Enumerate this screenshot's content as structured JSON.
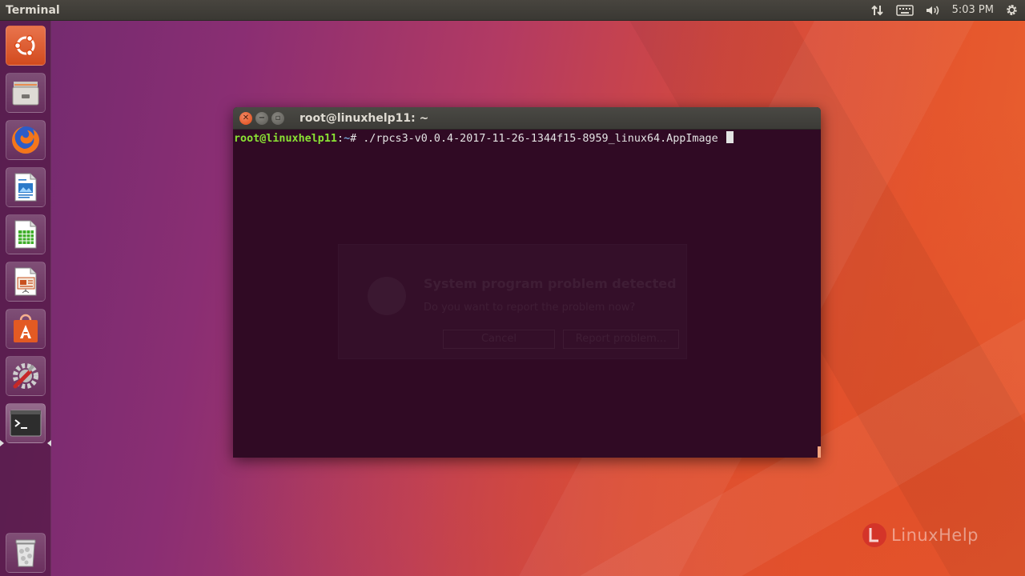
{
  "top_panel": {
    "app_title": "Terminal",
    "clock": "5:03 PM",
    "indicators": [
      "network-icon",
      "keyboard-icon",
      "volume-icon",
      "settings-gear-icon"
    ]
  },
  "launcher": {
    "items": [
      {
        "name": "ubuntu-dash",
        "icon": "ubuntu-logo-icon"
      },
      {
        "name": "files",
        "icon": "file-cabinet-icon"
      },
      {
        "name": "firefox",
        "icon": "firefox-icon"
      },
      {
        "name": "libreoffice-writer",
        "icon": "writer-document-icon"
      },
      {
        "name": "libreoffice-calc",
        "icon": "calc-spreadsheet-icon"
      },
      {
        "name": "libreoffice-impress",
        "icon": "impress-presentation-icon"
      },
      {
        "name": "ubuntu-software",
        "icon": "software-bag-icon"
      },
      {
        "name": "system-settings",
        "icon": "settings-tools-icon"
      },
      {
        "name": "terminal",
        "icon": "terminal-icon",
        "active": true
      },
      {
        "name": "trash",
        "icon": "trash-icon"
      }
    ]
  },
  "terminal": {
    "title": "root@linuxhelp11: ~",
    "prompt_user": "root@linuxhelp11",
    "prompt_path": "~",
    "prompt_symbol": "# ",
    "command": "./rpcs3-v0.0.4-2017-11-26-1344f15-8959_linux64.AppImage "
  },
  "background_dialog": {
    "title": "System program problem detected",
    "message": "Do you want to report the problem now?",
    "cancel_label": "Cancel",
    "report_label": "Report problem..."
  },
  "watermark": {
    "text": "LinuxHelp"
  },
  "colors": {
    "terminal_bg": "#300a24",
    "prompt_green": "#8ae234",
    "prompt_blue": "#729fcf",
    "accent_orange": "#dd4814"
  }
}
